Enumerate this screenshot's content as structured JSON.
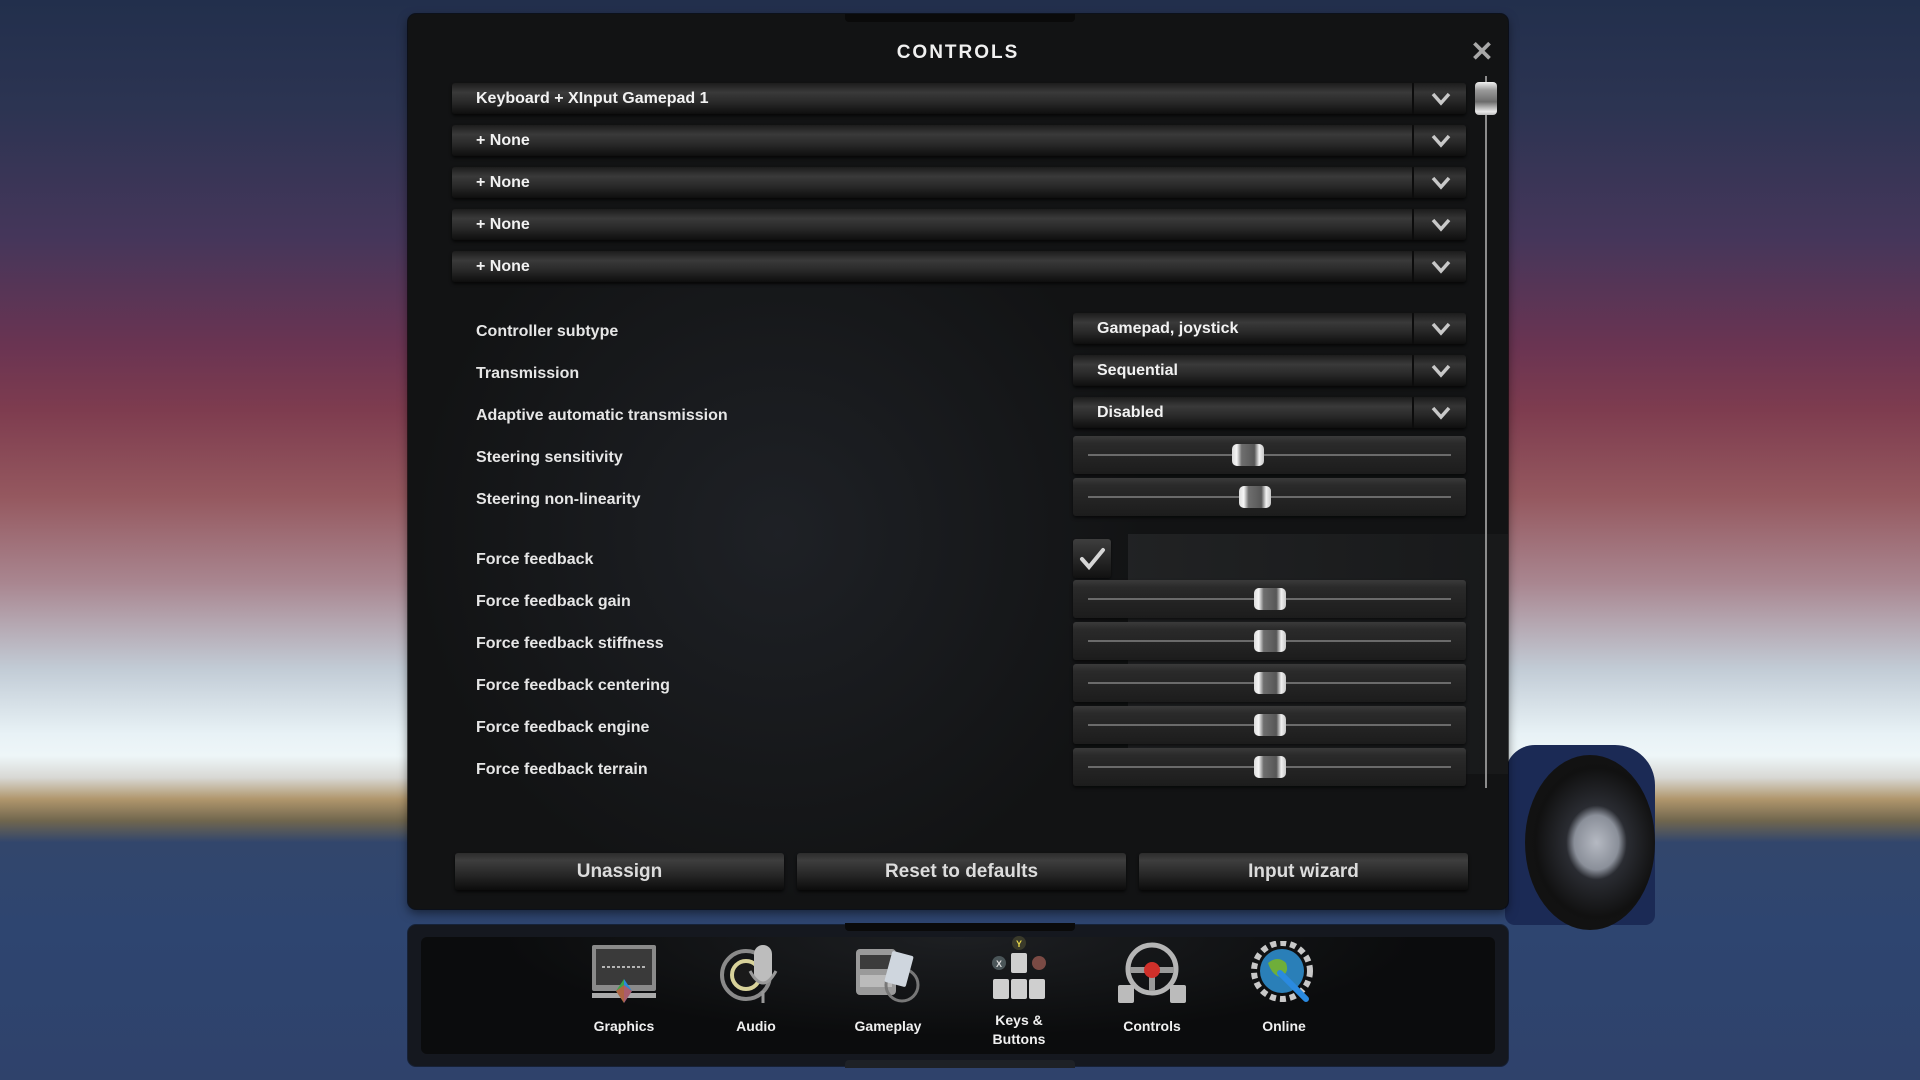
{
  "dialog": {
    "title": "CONTROLS",
    "close_icon": "close-icon"
  },
  "device_profiles": [
    {
      "label": "Keyboard + XInput Gamepad 1"
    },
    {
      "label": "+ None"
    },
    {
      "label": "+ None"
    },
    {
      "label": "+ None"
    },
    {
      "label": "+ None"
    }
  ],
  "settings": {
    "dropdowns": [
      {
        "label": "Controller subtype",
        "value": "Gamepad, joystick"
      },
      {
        "label": "Transmission",
        "value": "Sequential"
      },
      {
        "label": "Adaptive automatic transmission",
        "value": "Disabled"
      }
    ],
    "steering_sliders": [
      {
        "label": "Steering sensitivity",
        "value": 0.44
      },
      {
        "label": "Steering non-linearity",
        "value": 0.46
      }
    ],
    "force_feedback": {
      "label": "Force feedback",
      "checked": true
    },
    "ff_sliders": [
      {
        "label": "Force feedback gain",
        "value": 0.5
      },
      {
        "label": "Force feedback stiffness",
        "value": 0.5
      },
      {
        "label": "Force feedback centering",
        "value": 0.5
      },
      {
        "label": "Force feedback engine",
        "value": 0.5
      },
      {
        "label": "Force feedback terrain",
        "value": 0.5
      }
    ]
  },
  "scrollbar": {
    "position": 0.0
  },
  "buttons": {
    "unassign": "Unassign",
    "reset": "Reset to defaults",
    "wizard": "Input wizard"
  },
  "nav": [
    {
      "label": "Graphics",
      "icon": "monitor-icon"
    },
    {
      "label": "Audio",
      "icon": "microphone-speaker-icon"
    },
    {
      "label": "Gameplay",
      "icon": "truck-tablet-icon"
    },
    {
      "label": "Keys &",
      "label2": "Buttons",
      "icon": "keys-buttons-icon"
    },
    {
      "label": "Controls",
      "icon": "steering-wheel-icon"
    },
    {
      "label": "Online",
      "icon": "globe-gear-icon"
    }
  ]
}
